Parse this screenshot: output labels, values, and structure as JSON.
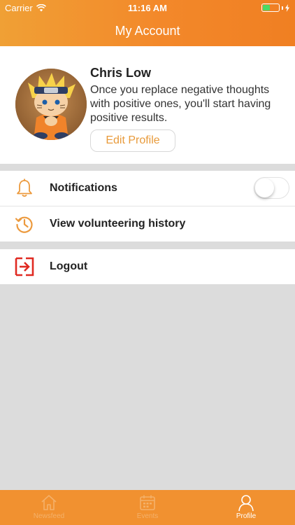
{
  "status_bar": {
    "carrier": "Carrier",
    "time": "11:16 AM",
    "battery_color": "#4cd964"
  },
  "header": {
    "title": "My Account",
    "accent_color": "#f3882a"
  },
  "profile": {
    "name": "Chris Low",
    "quote": "Once you replace negative thoughts with positive ones, you'll start having positive results.",
    "edit_label": "Edit Profile"
  },
  "menu": {
    "notifications": {
      "label": "Notifications",
      "icon": "bell-icon",
      "enabled": false
    },
    "history": {
      "label": "View volunteering history",
      "icon": "history-icon"
    },
    "logout": {
      "label": "Logout",
      "icon": "logout-icon"
    }
  },
  "tabs": [
    {
      "label": "Newsfeed",
      "icon": "home-icon",
      "active": false
    },
    {
      "label": "Events",
      "icon": "calendar-icon",
      "active": false
    },
    {
      "label": "Profile",
      "icon": "person-icon",
      "active": true
    }
  ]
}
